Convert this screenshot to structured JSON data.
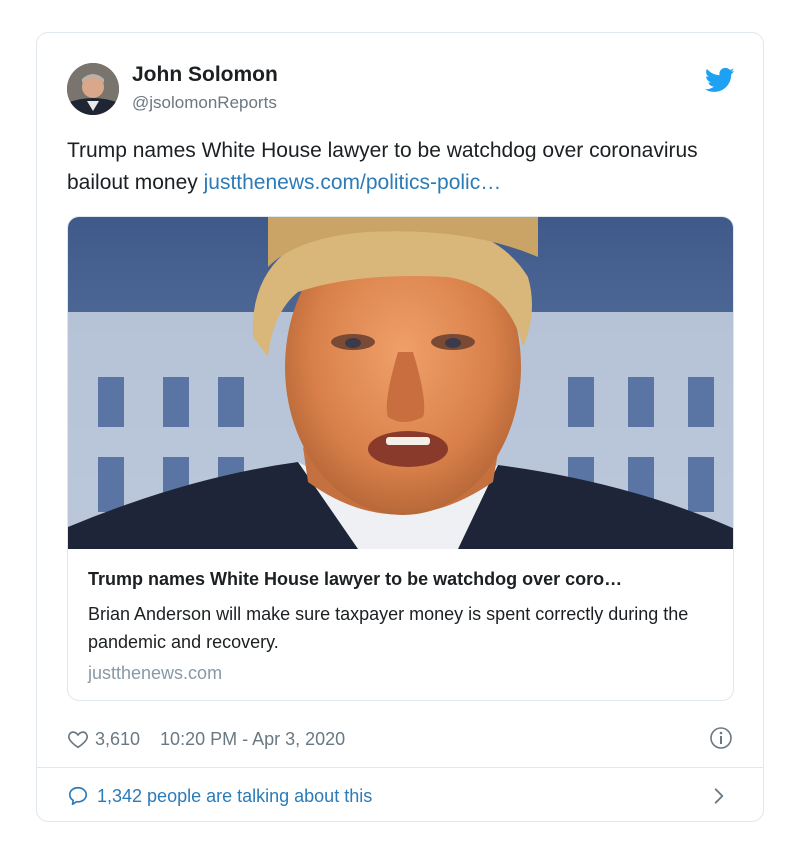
{
  "author": {
    "name": "John Solomon",
    "handle": "@jsolomonReports"
  },
  "icons": {
    "brand": "twitter-bird-icon",
    "like": "heart-icon",
    "info": "info-icon",
    "reply": "speech-bubble-icon",
    "more": "chevron-right-icon"
  },
  "tweet": {
    "text": "Trump names White House lawyer to be watchdog over coronavirus bailout money ",
    "link": "justthenews.com/politics-polic…"
  },
  "link_card": {
    "title": "Trump names White House lawyer to be watchdog over coro…",
    "description": "Brian Anderson will make sure taxpayer money is spent correctly during the pandemic and recovery.",
    "domain": "justthenews.com"
  },
  "stats": {
    "likes": "3,610",
    "timestamp": "10:20 PM - Apr 3, 2020"
  },
  "footer": {
    "talking": "1,342 people are talking about this"
  },
  "colors": {
    "link": "#2b7bb9",
    "brand": "#1da1f2",
    "muted": "#697882",
    "border": "#e1e8ed"
  }
}
